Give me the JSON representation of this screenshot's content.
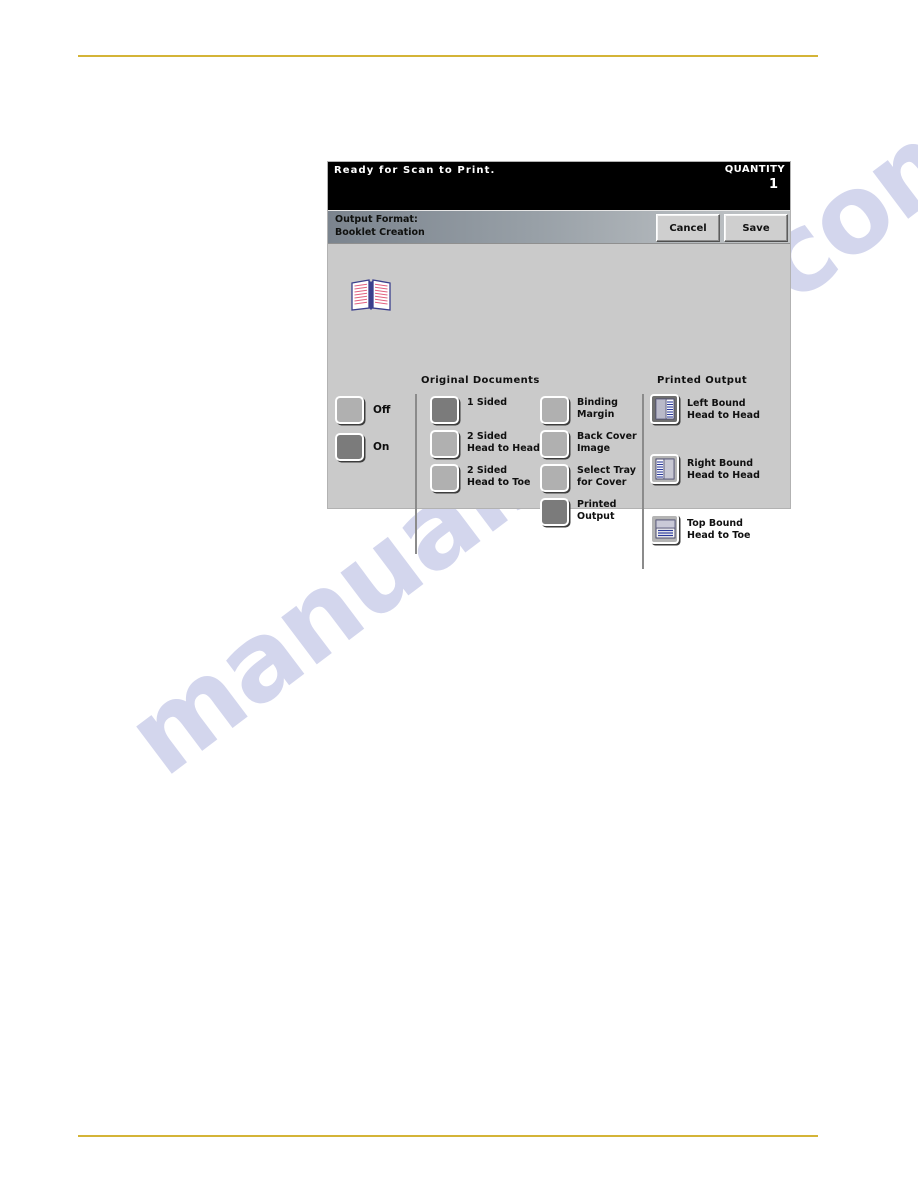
{
  "page": {
    "watermark": "manualshive.com"
  },
  "panel": {
    "status": {
      "message": "Ready  for  Scan  to  Print.",
      "quantity_label": "QUANTITY",
      "quantity_value": "1"
    },
    "titlebar": {
      "line1": "Output Format:",
      "line2": "Booklet Creation",
      "cancel_label": "Cancel",
      "save_label": "Save"
    },
    "booklet_icon": "open-book-icon",
    "toggle": {
      "options": [
        {
          "label": "Off",
          "selected": false
        },
        {
          "label": "On",
          "selected": true
        }
      ]
    },
    "originals": {
      "heading": "Original  Documents",
      "options": [
        {
          "line1": "1  Sided",
          "line2": "",
          "selected": true
        },
        {
          "line1": "2  Sided",
          "line2": "Head  to  Head",
          "selected": false
        },
        {
          "line1": "2  Sided",
          "line2": "Head  to  Toe",
          "selected": false
        }
      ]
    },
    "middle": {
      "options": [
        {
          "line1": "Binding",
          "line2": "Margin",
          "selected": false
        },
        {
          "line1": "Back  Cover",
          "line2": "Image",
          "selected": false
        },
        {
          "line1": "Select  Tray",
          "line2": "for  Cover",
          "selected": false
        },
        {
          "line1": "Printed",
          "line2": "Output",
          "selected": true
        }
      ]
    },
    "printed": {
      "heading": "Printed  Output",
      "options": [
        {
          "line1": "Left  Bound",
          "line2": "Head  to  Head",
          "icon": "left-bound-icon",
          "selected": true
        },
        {
          "line1": "Right  Bound",
          "line2": "Head  to  Head",
          "icon": "right-bound-icon",
          "selected": false
        },
        {
          "line1": "Top  Bound",
          "line2": "Head  to  Toe",
          "icon": "top-bound-icon",
          "selected": false
        }
      ]
    }
  },
  "colors": {
    "rule": "#d4b437",
    "panel_bg": "#cacaca",
    "status_bg": "#000000",
    "selected": "#7b7b7b",
    "unselected": "#b0b0b0"
  }
}
